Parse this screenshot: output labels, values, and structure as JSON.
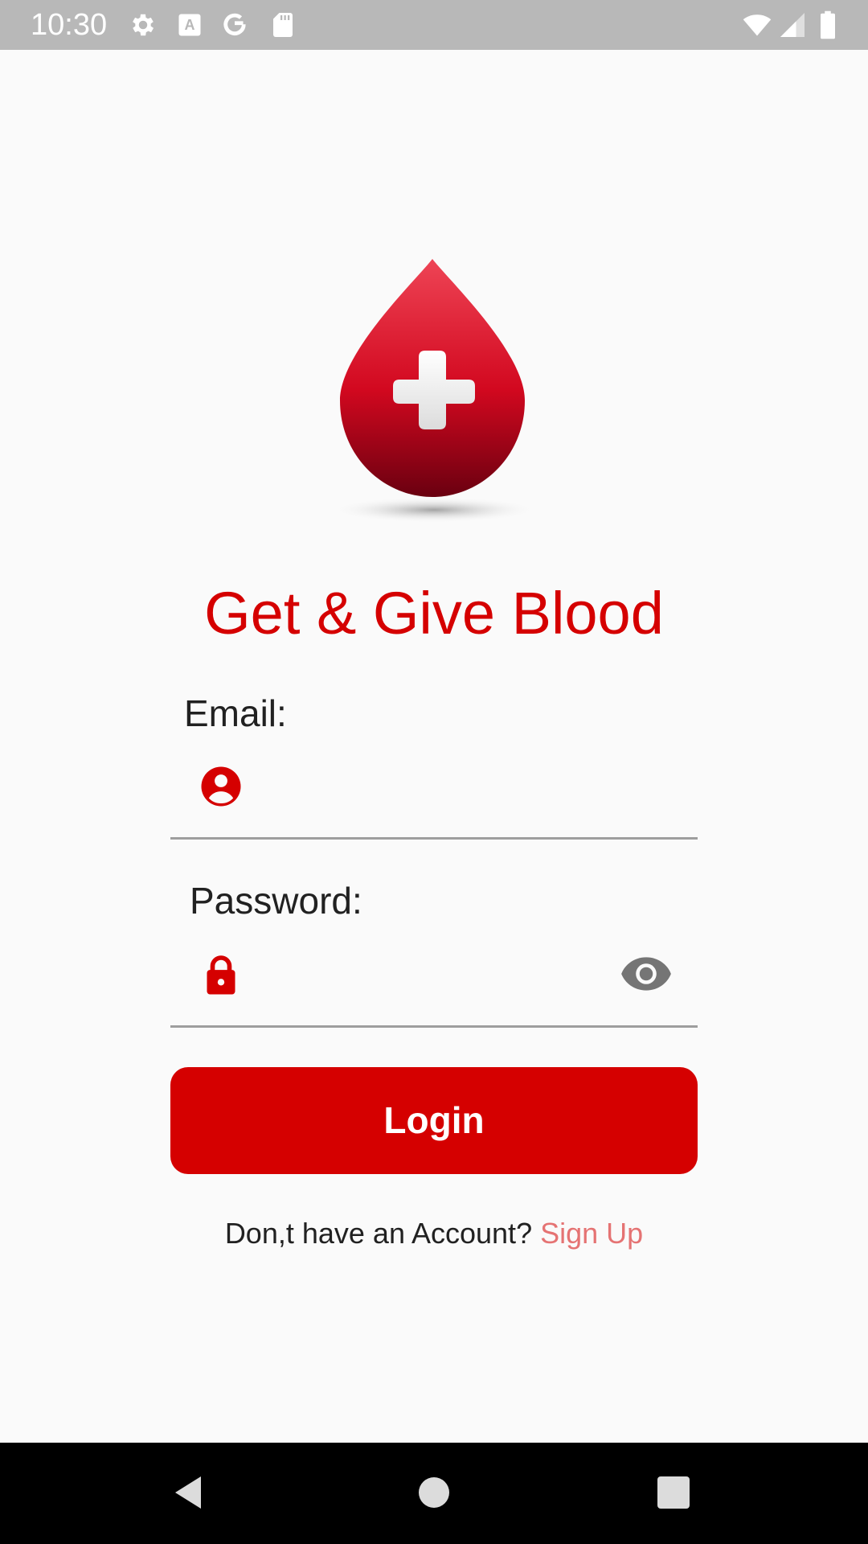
{
  "status_bar": {
    "time": "10:30",
    "icons": [
      "settings-icon",
      "a11y-text-icon",
      "google-icon",
      "sd-card-icon",
      "wifi-icon",
      "cell-signal-icon",
      "battery-icon"
    ],
    "text_color": "#ffffff",
    "background": "#b8b8b8"
  },
  "logo": {
    "icon": "blood-drop-cross-icon",
    "color": "#d50000"
  },
  "app": {
    "title": "Get & Give Blood",
    "accent_color": "#d50000"
  },
  "form": {
    "email_label": "Email:",
    "email_value": "",
    "email_icon": "person-icon",
    "password_label": "Password:",
    "password_value": "",
    "password_icon": "lock-icon",
    "visibility_icon": "eye-icon",
    "login_label": "Login"
  },
  "signup": {
    "prompt": "Don,t have an Account? ",
    "link_label": "Sign Up",
    "link_color": "#e57373"
  },
  "nav_bar": {
    "buttons": [
      "back-icon",
      "home-icon",
      "recents-icon"
    ]
  }
}
